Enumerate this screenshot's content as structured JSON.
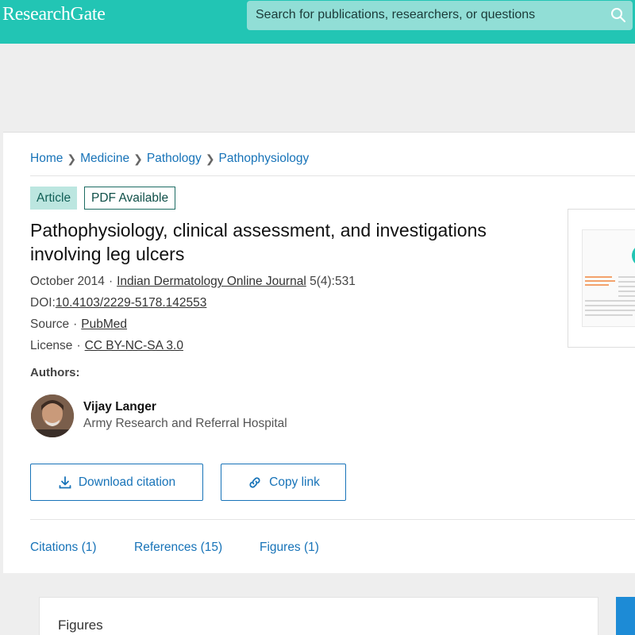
{
  "header": {
    "logo": "ResearchGate",
    "search_placeholder": "Search for publications, researchers, or questions"
  },
  "breadcrumb": [
    "Home",
    "Medicine",
    "Pathology",
    "Pathophysiology"
  ],
  "badges": {
    "type": "Article",
    "pdf": "PDF Available"
  },
  "article": {
    "title": "Pathophysiology, clinical assessment, and investigations involving leg ulcers",
    "date": "October 2014",
    "journal": "Indian Dermatology Online Journal",
    "volume": "5(4):531",
    "doi_label": "DOI:",
    "doi": "10.4103/2229-5178.142553",
    "source_label": "Source",
    "source": "PubMed",
    "license_label": "License",
    "license": "CC BY-NC-SA 3.0"
  },
  "authors": {
    "label": "Authors:",
    "list": [
      {
        "name": "Vijay Langer",
        "affiliation": "Army Research and Referral Hospital"
      }
    ]
  },
  "actions": {
    "download": "Download citation",
    "copy": "Copy link"
  },
  "tabs": [
    "Citations (1)",
    "References (15)",
    "Figures (1)"
  ],
  "figures_section": {
    "title": "Figures"
  },
  "colors": {
    "brand": "#22c5b4",
    "link": "#1773b8"
  }
}
